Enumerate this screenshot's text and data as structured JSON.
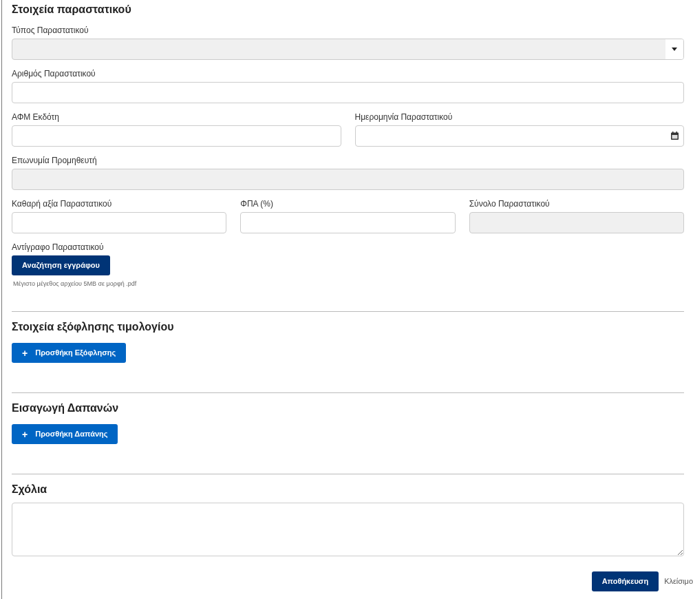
{
  "sections": [
    {
      "title": "Στοιχεία παραστατικού",
      "rows": [
        [
          {
            "label": "Τύπος Παραστατικού",
            "kind": "select",
            "disabled": true
          }
        ],
        [
          {
            "label": "Αριθμός Παραστατικού",
            "kind": "text",
            "disabled": false
          }
        ],
        [
          {
            "label": "ΑΦΜ Εκδότη",
            "kind": "text",
            "disabled": false
          },
          {
            "label": "Ημερομηνία Παραστατικού",
            "kind": "date",
            "disabled": false
          }
        ],
        [
          {
            "label": "Επωνυμία Προμηθευτή",
            "kind": "text",
            "disabled": true
          }
        ],
        [
          {
            "label": "Καθαρή αξία Παραστατικού",
            "kind": "text",
            "disabled": false
          },
          {
            "label": "ΦΠΑ (%)",
            "kind": "text",
            "disabled": false
          },
          {
            "label": "Σύνολο Παραστατικού",
            "kind": "text",
            "disabled": true
          }
        ]
      ],
      "upload": {
        "label": "Αντίγραφο Παραστατικού",
        "button": "Αναζήτηση εγγράφου",
        "hint": "Μέγιστο μέγεθος αρχείου 5MB σε μορφή .pdf"
      }
    },
    {
      "title": "Στοιχεία εξόφλησης τιμολογίου",
      "add_button": {
        "icon": "+",
        "label": "Προσθήκη Εξόφλησης"
      }
    },
    {
      "title": "Εισαγωγή Δαπανών",
      "add_button": {
        "icon": "+",
        "label": "Προσθήκη Δαπάνης"
      }
    },
    {
      "title": "Σχόλια",
      "textarea": true
    }
  ],
  "footer": {
    "save": "Αποθήκευση",
    "close": "Κλείσιμο"
  }
}
